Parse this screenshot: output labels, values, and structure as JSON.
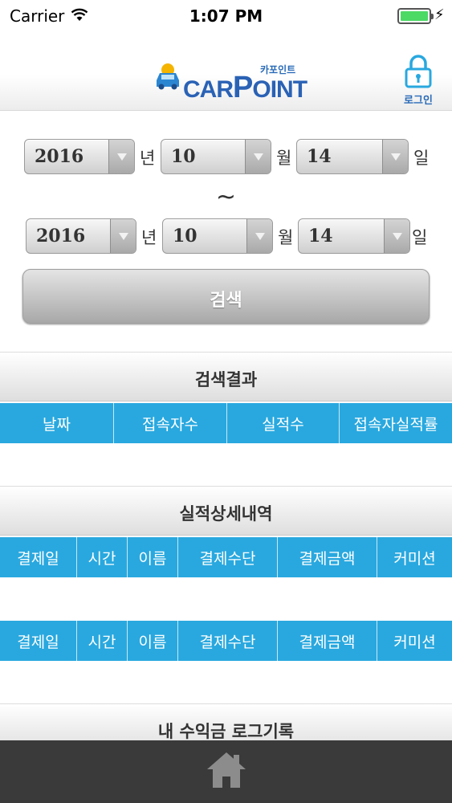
{
  "status_bar": {
    "carrier": "Carrier",
    "time": "1:07 PM"
  },
  "header": {
    "logo_korean": "카포인트",
    "logo_car": "CAR",
    "logo_p": "P",
    "logo_rest": "OINT",
    "login_label": "로그인"
  },
  "date_from": {
    "year": "2016",
    "year_unit": "년",
    "month": "10",
    "month_unit": "월",
    "day": "14",
    "day_unit": "일"
  },
  "date_sep": "~",
  "date_to": {
    "year": "2016",
    "year_unit": "년",
    "month": "10",
    "month_unit": "월",
    "day": "14",
    "day_unit": "일"
  },
  "search_button": "검색",
  "results": {
    "title": "검색결과",
    "columns": [
      "날짜",
      "접속자수",
      "실적수",
      "접속자실적률"
    ]
  },
  "performance_detail": {
    "title": "실적상세내역",
    "columns": [
      "결제일",
      "시간",
      "이름",
      "결제수단",
      "결제금액",
      "커미션"
    ]
  },
  "second_table": {
    "columns": [
      "결제일",
      "시간",
      "이름",
      "결제수단",
      "결제금액",
      "커미션"
    ]
  },
  "income_log": {
    "title": "내 수익금 로그기록"
  },
  "colors": {
    "accent": "#29a8df",
    "brand": "#2a62b5",
    "bottom_bar": "#3a3a3a"
  }
}
